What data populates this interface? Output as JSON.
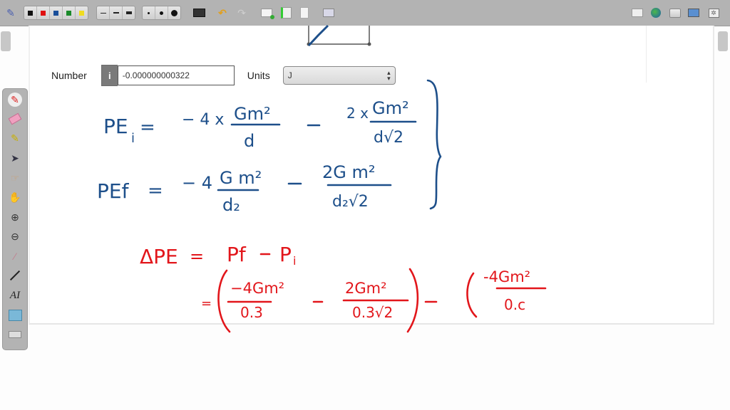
{
  "toolbar": {
    "pen_colors": [
      {
        "name": "black",
        "hex": "#111111"
      },
      {
        "name": "red",
        "hex": "#e01010"
      },
      {
        "name": "blue",
        "hex": "#1a4f9a"
      },
      {
        "name": "green",
        "hex": "#1a8a2a"
      },
      {
        "name": "yellow",
        "hex": "#f0dc20"
      }
    ],
    "line_widths": [
      "thin",
      "medium",
      "thick"
    ],
    "point_sizes": [
      "small",
      "medium",
      "large"
    ],
    "left_icons": [
      "pen-tool-icon",
      "keyboard-icon",
      "undo-icon",
      "redo-icon",
      "new-page-icon",
      "next-page-icon",
      "previous-page-icon",
      "record-icon"
    ],
    "right_icons": [
      "whiteboard-icon",
      "web-icon",
      "folder-icon",
      "desktop-icon",
      "settings-icon"
    ]
  },
  "question": {
    "number_label": "Number",
    "info_glyph": "i",
    "number_value": "-0.000000000322",
    "units_label": "Units",
    "units_value": "J"
  },
  "palette": {
    "tools": [
      "pen",
      "eraser",
      "highlighter",
      "select",
      "interact",
      "hand",
      "zoom-in",
      "zoom-out",
      "laser-pointer",
      "line",
      "text",
      "capture",
      "erase-all"
    ],
    "text_tool_glyph": "AI"
  },
  "ink": {
    "blue_color": "#1d4f8a",
    "red_color": "#e2161b",
    "line1": "PE_i = −4 × Gm²/d − 2 × Gm²/(d√2)",
    "line2": "PE_f = −4 Gm²/d₂ − 2Gm²/(d₂√2)",
    "line3": "ΔPE = P_f − P_i",
    "line4": "= (−4Gm²/0.3 − 2Gm²/(0.3√2)) − (−4Gm²/0.…"
  }
}
